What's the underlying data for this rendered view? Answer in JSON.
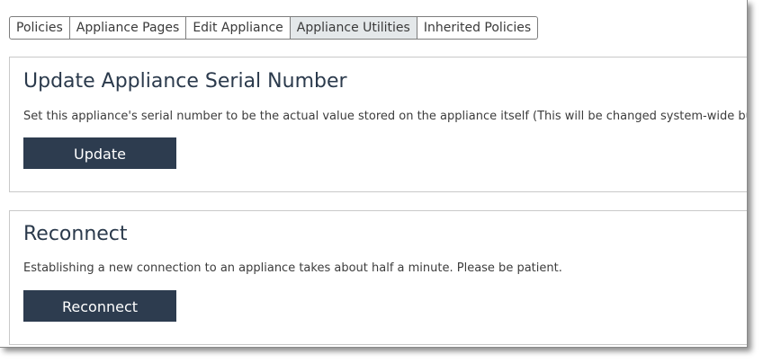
{
  "tabs": [
    {
      "label": "Policies",
      "active": false
    },
    {
      "label": "Appliance Pages",
      "active": false
    },
    {
      "label": "Edit Appliance",
      "active": false
    },
    {
      "label": "Appliance Utilities",
      "active": true
    },
    {
      "label": "Inherited Policies",
      "active": false
    }
  ],
  "serial_section": {
    "title": "Update Appliance Serial Number",
    "description": "Set this appliance's serial number to be the actual value stored on the appliance itself (This will be changed system-wide but",
    "button_label": "Update"
  },
  "reconnect_section": {
    "title": "Reconnect",
    "description": "Establishing a new connection to an appliance takes about half a minute. Please be patient.",
    "button_label": "Reconnect"
  },
  "colors": {
    "button_bg": "#2d3c4f",
    "title_text": "#2b3a4c",
    "active_tab_bg": "#e4e8ea"
  }
}
